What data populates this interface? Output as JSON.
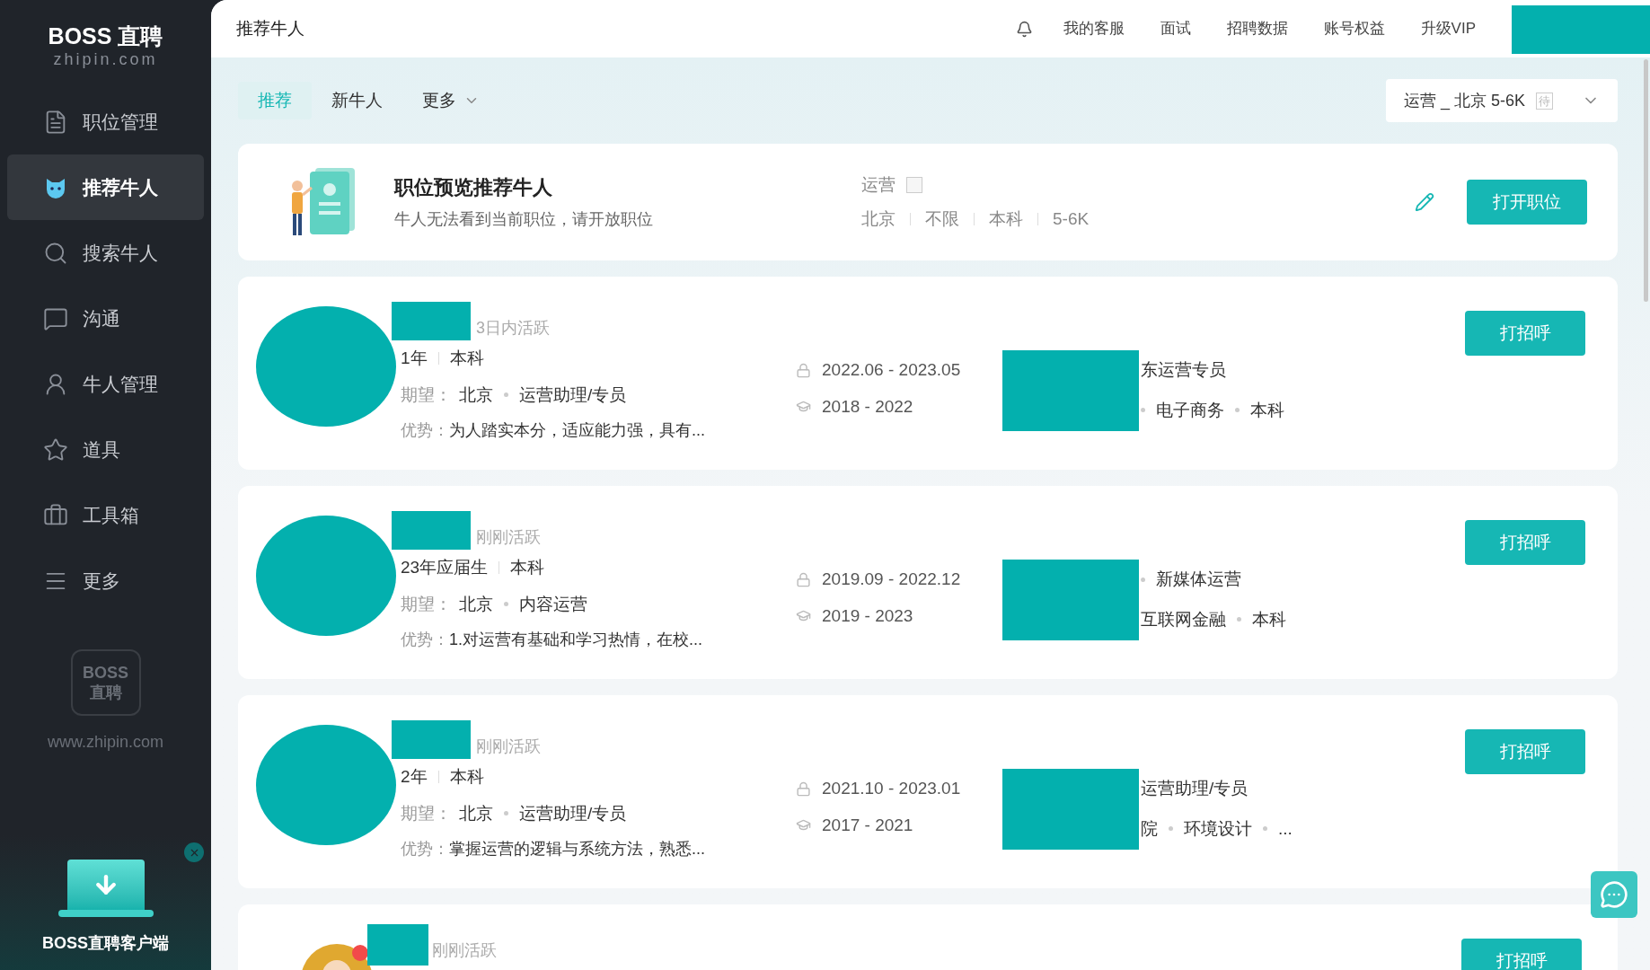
{
  "sidebar": {
    "logo": {
      "title": "BOSS 直聘",
      "subtitle": "zhipin.com"
    },
    "items": [
      {
        "label": "职位管理",
        "selected": false
      },
      {
        "label": "推荐牛人",
        "selected": true
      },
      {
        "label": "搜索牛人",
        "selected": false
      },
      {
        "label": "沟通",
        "selected": false
      },
      {
        "label": "牛人管理",
        "selected": false
      },
      {
        "label": "道具",
        "selected": false
      },
      {
        "label": "工具箱",
        "selected": false
      },
      {
        "label": "更多",
        "selected": false
      }
    ],
    "brand_mark": {
      "lines": [
        "BOSS",
        "直聘"
      ],
      "url": "www.zhipin.com"
    },
    "client_promo": {
      "label": "BOSS直聘客户端"
    }
  },
  "top_bar": {
    "title": "推荐牛人",
    "links": [
      "我的客服",
      "面试",
      "招聘数据",
      "账号权益",
      "升级VIP"
    ]
  },
  "tabs": [
    {
      "label": "推荐",
      "selected": true,
      "dropdown": false
    },
    {
      "label": "新牛人",
      "selected": false,
      "dropdown": false
    },
    {
      "label": "更多",
      "selected": false,
      "dropdown": true
    }
  ],
  "job_selector": {
    "value": "运营 _ 北京 5-6K",
    "badge": "待"
  },
  "job_card": {
    "title": "职位预览推荐牛人",
    "subtitle": "牛人无法看到当前职位，请开放职位",
    "job_name": "运营",
    "tags": [
      "北京",
      "不限",
      "本科",
      "5-6K"
    ],
    "button": "打开职位"
  },
  "candidates": [
    {
      "kind": "redacted",
      "status": "3日内活跃",
      "basics": [
        "1年",
        "本科"
      ],
      "expect_label": "期望：",
      "expect": [
        "北京",
        "运营助理/专员"
      ],
      "advantage_label": "优势：",
      "advantage": "为人踏实本分，适应能力强，具有...",
      "work_dates": "2022.06 - 2023.05",
      "edu_dates": "2018 - 2022",
      "work": {
        "leading_dot": false,
        "items": [
          "东运营专员"
        ]
      },
      "edu": {
        "leading_dot": true,
        "items": [
          "电子商务",
          "本科"
        ]
      },
      "button": "打招呼"
    },
    {
      "kind": "redacted",
      "status": "刚刚活跃",
      "basics": [
        "23年应届生",
        "本科"
      ],
      "expect_label": "期望：",
      "expect": [
        "北京",
        "内容运营"
      ],
      "advantage_label": "优势：",
      "advantage": "1.对运营有基础和学习热情，在校...",
      "work_dates": "2019.09 - 2022.12",
      "edu_dates": "2019 - 2023",
      "work": {
        "leading_dot": true,
        "items": [
          "新媒体运营"
        ]
      },
      "edu": {
        "leading_dot": false,
        "items": [
          "互联网金融",
          "本科"
        ]
      },
      "button": "打招呼"
    },
    {
      "kind": "redacted",
      "status": "刚刚活跃",
      "basics": [
        "2年",
        "本科"
      ],
      "expect_label": "期望：",
      "expect": [
        "北京",
        "运营助理/专员"
      ],
      "advantage_label": "优势：",
      "advantage": "掌握运营的逻辑与系统方法，熟悉...",
      "work_dates": "2021.10 - 2023.01",
      "edu_dates": "2017 - 2021",
      "work": {
        "leading_dot": false,
        "items": [
          "运营助理/专员"
        ]
      },
      "edu": {
        "leading_dot": false,
        "items": [
          "院",
          "环境设计",
          "..."
        ]
      },
      "button": "打招呼"
    },
    {
      "kind": "partial",
      "status": "刚刚活跃",
      "button": "打招呼"
    }
  ]
}
